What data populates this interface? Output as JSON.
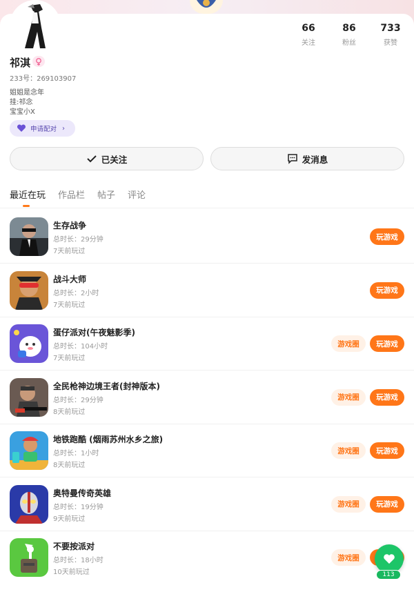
{
  "profile": {
    "name": "祁淇",
    "uid": "233号：269103907",
    "bio": [
      "姐姐是念年",
      "挂:祁念",
      "宝宝小X"
    ],
    "pair_label": "申请配对",
    "stats": [
      {
        "num": "66",
        "label": "关注"
      },
      {
        "num": "86",
        "label": "粉丝"
      },
      {
        "num": "733",
        "label": "获赞"
      }
    ]
  },
  "actions": {
    "follow_label": "已关注",
    "message_label": "发消息"
  },
  "tabs": [
    "最近在玩",
    "作品栏",
    "帖子",
    "评论"
  ],
  "games": [
    {
      "name": "生存战争",
      "time": "总时长：29分钟",
      "last": "7天前玩过",
      "circle": false,
      "icon": "survival-war-icon"
    },
    {
      "name": "战斗大师",
      "time": "总时长：2小时",
      "last": "7天前玩过",
      "circle": false,
      "icon": "battle-master-icon"
    },
    {
      "name": "蛋仔派对(午夜魅影季)",
      "time": "总时长：104小时",
      "last": "7天前玩过",
      "circle": true,
      "icon": "eggy-party-icon"
    },
    {
      "name": "全民枪神边境王者(封神版本)",
      "time": "总时长：29分钟",
      "last": "8天前玩过",
      "circle": true,
      "icon": "gun-god-icon"
    },
    {
      "name": "地铁跑酷 (烟雨苏州水乡之旅)",
      "time": "总时长：1小时",
      "last": "8天前玩过",
      "circle": true,
      "icon": "subway-surfers-icon"
    },
    {
      "name": "奥特曼传奇英雄",
      "time": "总时长：19分钟",
      "last": "9天前玩过",
      "circle": true,
      "icon": "ultraman-icon"
    },
    {
      "name": "不要按派对",
      "time": "总时长：18小时",
      "last": "10天前玩过",
      "circle": true,
      "icon": "dont-press-party-icon"
    }
  ],
  "buttons": {
    "play_label": "玩游戏",
    "circle_label": "游戏圈"
  },
  "fab": {
    "count": "113"
  },
  "colors": {
    "accent": "#ff7618",
    "fab": "#1dc568",
    "pair": "#5b4bb0"
  }
}
